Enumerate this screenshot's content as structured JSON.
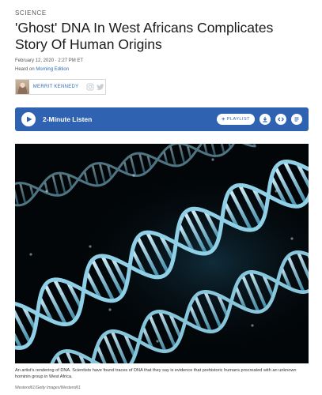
{
  "section": "Science",
  "headline": "'Ghost' DNA In West Africans Complicates Story Of Human Origins",
  "dateline": "February 12, 2020 · 2:27 PM ET",
  "heard_on": {
    "prefix": "Heard on",
    "program": "Morning Edition"
  },
  "byline": {
    "author": "Merrit Kennedy",
    "icons": [
      "instagram-icon",
      "twitter-icon"
    ]
  },
  "player": {
    "listen_label": "2-Minute Listen",
    "playlist_label": "Playlist",
    "playlist_plus": "+",
    "buttons": [
      "download-icon",
      "embed-icon",
      "transcript-icon"
    ],
    "accent": "#2f63b1"
  },
  "image": {
    "caption": "An artist's rendering of DNA. Scientists have found traces of DNA that they say is evidence that prehistoric humans procreated with an unknown hominin group in West Africa.",
    "credit": "Westend61/Getty Images/Westend61"
  },
  "colors": {
    "link": "#2d6bb6",
    "helix": "#8fd0e6",
    "background": "#020608"
  }
}
